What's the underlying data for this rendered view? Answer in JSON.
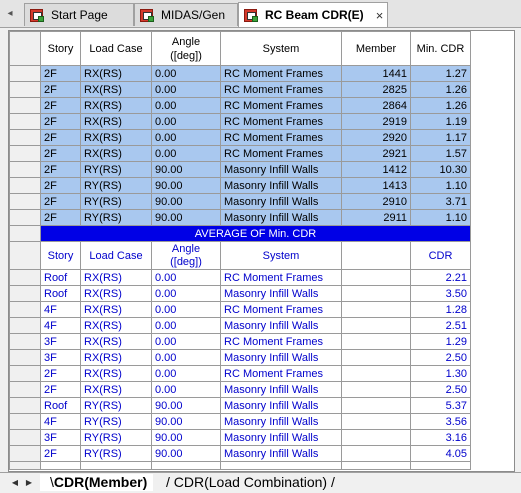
{
  "tabs": [
    {
      "label": "Start Page"
    },
    {
      "label": "MIDAS/Gen"
    },
    {
      "label": "RC Beam CDR(E)"
    }
  ],
  "tab_close_glyph": "×",
  "table1": {
    "headers": [
      "Story",
      "Load Case",
      "Angle ([deg])",
      "System",
      "Member",
      "Min. CDR"
    ],
    "rows": [
      [
        "2F",
        "RX(RS)",
        "0.00",
        "RC Moment Frames",
        "1441",
        "1.27"
      ],
      [
        "2F",
        "RX(RS)",
        "0.00",
        "RC Moment Frames",
        "2825",
        "1.26"
      ],
      [
        "2F",
        "RX(RS)",
        "0.00",
        "RC Moment Frames",
        "2864",
        "1.26"
      ],
      [
        "2F",
        "RX(RS)",
        "0.00",
        "RC Moment Frames",
        "2919",
        "1.19"
      ],
      [
        "2F",
        "RX(RS)",
        "0.00",
        "RC Moment Frames",
        "2920",
        "1.17"
      ],
      [
        "2F",
        "RX(RS)",
        "0.00",
        "RC Moment Frames",
        "2921",
        "1.57"
      ],
      [
        "2F",
        "RY(RS)",
        "90.00",
        "Masonry Infill Walls",
        "1412",
        "10.30"
      ],
      [
        "2F",
        "RY(RS)",
        "90.00",
        "Masonry Infill Walls",
        "1413",
        "1.10"
      ],
      [
        "2F",
        "RY(RS)",
        "90.00",
        "Masonry Infill Walls",
        "2910",
        "3.71"
      ],
      [
        "2F",
        "RY(RS)",
        "90.00",
        "Masonry Infill Walls",
        "2911",
        "1.10"
      ]
    ]
  },
  "banner": "AVERAGE OF Min. CDR",
  "table2": {
    "headers": [
      "Story",
      "Load Case",
      "Angle ([deg])",
      "System",
      "",
      "CDR"
    ],
    "rows": [
      [
        "Roof",
        "RX(RS)",
        "0.00",
        "RC Moment Frames",
        "",
        "2.21"
      ],
      [
        "Roof",
        "RX(RS)",
        "0.00",
        "Masonry Infill Walls",
        "",
        "3.50"
      ],
      [
        "4F",
        "RX(RS)",
        "0.00",
        "RC Moment Frames",
        "",
        "1.28"
      ],
      [
        "4F",
        "RX(RS)",
        "0.00",
        "Masonry Infill Walls",
        "",
        "2.51"
      ],
      [
        "3F",
        "RX(RS)",
        "0.00",
        "RC Moment Frames",
        "",
        "1.29"
      ],
      [
        "3F",
        "RX(RS)",
        "0.00",
        "Masonry Infill Walls",
        "",
        "2.50"
      ],
      [
        "2F",
        "RX(RS)",
        "0.00",
        "RC Moment Frames",
        "",
        "1.30"
      ],
      [
        "2F",
        "RX(RS)",
        "0.00",
        "Masonry Infill Walls",
        "",
        "2.50"
      ],
      [
        "Roof",
        "RY(RS)",
        "90.00",
        "Masonry Infill Walls",
        "",
        "5.37"
      ],
      [
        "4F",
        "RY(RS)",
        "90.00",
        "Masonry Infill Walls",
        "",
        "3.56"
      ],
      [
        "3F",
        "RY(RS)",
        "90.00",
        "Masonry Infill Walls",
        "",
        "3.16"
      ],
      [
        "2F",
        "RY(RS)",
        "90.00",
        "Masonry Infill Walls",
        "",
        "4.05"
      ]
    ]
  },
  "sheet_tabs": [
    {
      "label": "CDR(Member)"
    },
    {
      "label": "CDR(Load Combination)"
    }
  ],
  "colors": {
    "selection": "#a9c8ef",
    "banner": "#0000e6",
    "summary_text": "#0000cc"
  },
  "icons": {
    "tab_scroll_left": "triangle-left-icon",
    "tab_app": "midas-app-icon",
    "sheet_prev": "triangle-left-icon",
    "sheet_next": "triangle-right-icon"
  }
}
